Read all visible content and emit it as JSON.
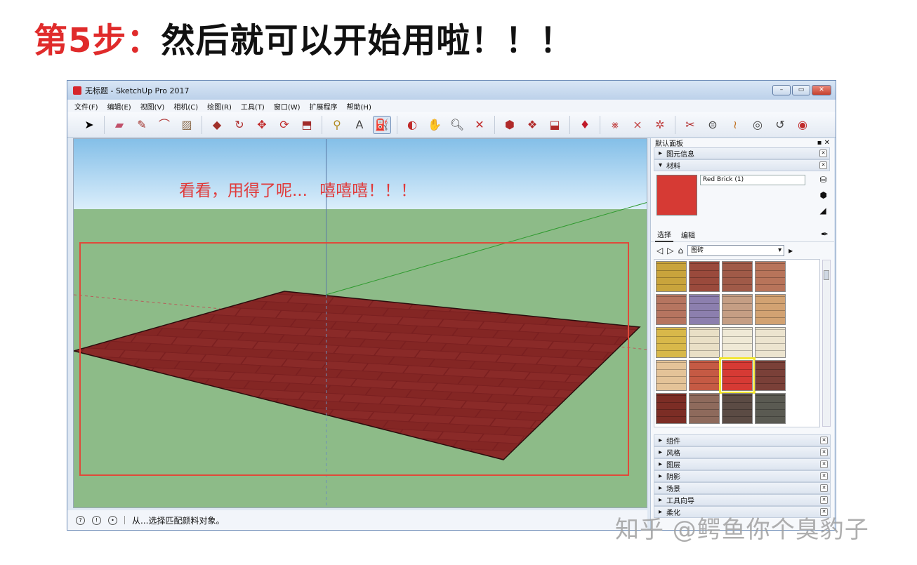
{
  "heading": {
    "step": "第5步：",
    "text": "然后就可以开始用啦！！！"
  },
  "window": {
    "title": "无标题 - SketchUp Pro 2017",
    "controls": [
      "–",
      "▭",
      "✕"
    ]
  },
  "menu": [
    "文件(F)",
    "编辑(E)",
    "视图(V)",
    "相机(C)",
    "绘图(R)",
    "工具(T)",
    "窗口(W)",
    "扩展程序",
    "帮助(H)"
  ],
  "toolbar_icons": [
    "select-arrow",
    "eraser",
    "pencil-line",
    "arc",
    "rectangle",
    "push-pull",
    "follow-me",
    "move",
    "rotate",
    "scale",
    "tape-measure",
    "text",
    "paint-bucket",
    "orbit",
    "pan",
    "zoom",
    "zoom-extents",
    "warehouse",
    "components",
    "extension",
    "ruby",
    "section-cuts",
    "section-plane",
    "look-around",
    "walk",
    "position-camera"
  ],
  "viewport": {
    "overlay_text_a": "看看，用得了呢...",
    "overlay_text_b": "嘻嘻嘻！！！",
    "floor_color": "#7a1f20"
  },
  "status": {
    "text": "从...选择匹配颜料对象。"
  },
  "tray": {
    "title": "默认面板",
    "panels_top": [
      "图元信息",
      "材料"
    ],
    "material_name": "Red Brick (1)",
    "tabs": [
      "选择",
      "编辑"
    ],
    "category": "图砖",
    "swatches": [
      "#c9a43c",
      "#9a4a3c",
      "#a05a48",
      "#b8745a",
      "#b67560",
      "#8c7fae",
      "#c59e84",
      "#d2a272",
      "#d8b84a",
      "#e9dfc6",
      "#efe9d6",
      "#ece4cf",
      "#e4c398",
      "#c55a44",
      "#d63a34",
      "#7a4038",
      "#7c2d25",
      "#8e6a5c",
      "#5b4b44",
      "#5a5a52"
    ],
    "selected_index": 14,
    "panels_bottom": [
      "组件",
      "风格",
      "图层",
      "阴影",
      "场景",
      "工具向导",
      "柔化"
    ]
  },
  "watermark": "知乎 @鳄鱼你个臭豹子"
}
